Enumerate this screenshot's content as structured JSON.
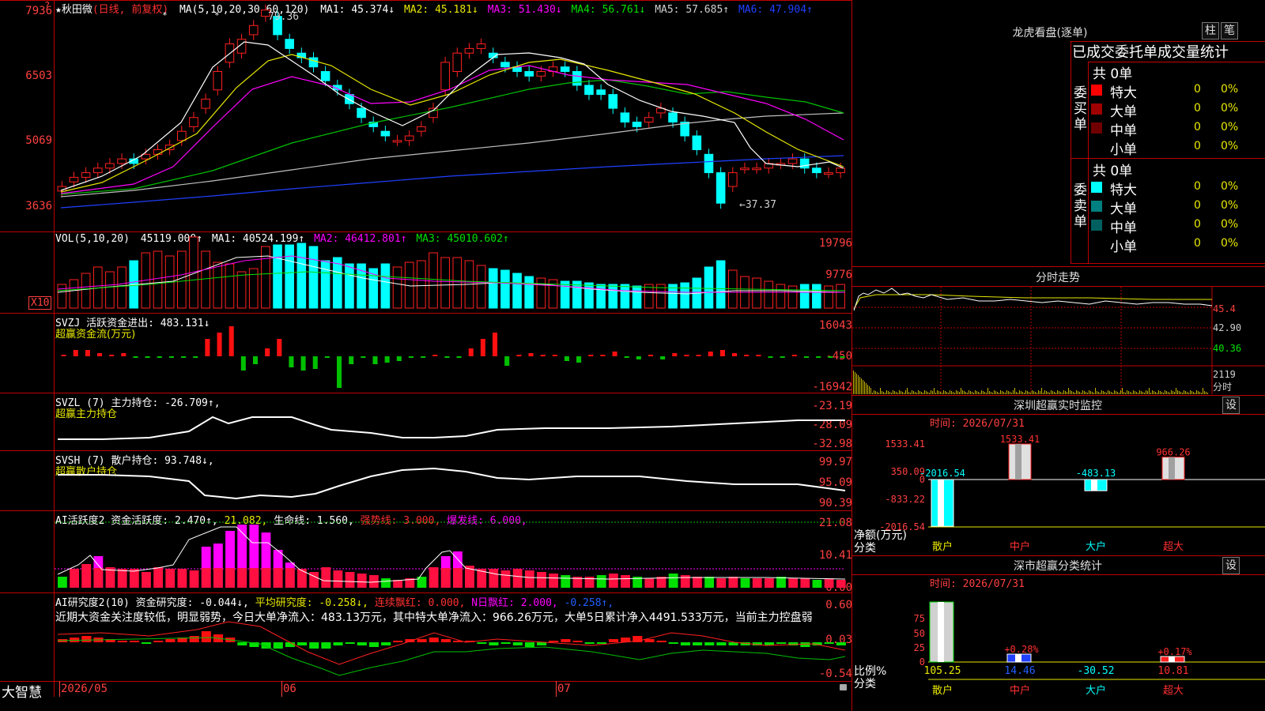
{
  "stock": {
    "star": "★",
    "name": "秋田微",
    "period": "(日线, 前复权)"
  },
  "ma_legend": {
    "params": "MA(5,10,20,30,60,120)",
    "items": [
      {
        "label": "MA1: 45.374↓",
        "color": "#ffffff"
      },
      {
        "label": "MA2: 45.181↓",
        "color": "#e8e800"
      },
      {
        "label": "MA3: 51.430↓",
        "color": "#ff00ff"
      },
      {
        "label": "MA4: 56.761↓",
        "color": "#00e000"
      },
      {
        "label": "MA5: 57.685↑",
        "color": "#c0c0c0"
      },
      {
        "label": "MA6: 47.904↑",
        "color": "#0000ff"
      }
    ]
  },
  "price_axis": [
    "7936",
    "6503",
    "5069",
    "3636"
  ],
  "price_annotations": {
    "high": "79.36",
    "low": "←37.37",
    "question": "?"
  },
  "vol_legend": {
    "params": "VOL(5,10,20)",
    "value": "45119.000↑",
    "items": [
      {
        "label": "MA1: 40524.199↑",
        "color": "#ffffff"
      },
      {
        "label": "MA2: 46412.801↑",
        "color": "#ff00ff"
      },
      {
        "label": "MA3: 45010.602↑",
        "color": "#00e000"
      }
    ]
  },
  "vol_axis": [
    "19796",
    "9776"
  ],
  "vol_unit": "X10",
  "svzj": {
    "title": "SVZJ  活跃资金进出: 483.131↓",
    "sub": "超赢资金流(万元)",
    "axis": [
      "16043",
      "-450",
      "-16942"
    ]
  },
  "svzl": {
    "title": "SVZL (7) 主力持仓: -26.709↑,",
    "sub": "超赢主力持仓",
    "axis": [
      "-23.19",
      "-28.09",
      "-32.98"
    ]
  },
  "svsh": {
    "title": "SVSH (7) 散户持仓: 93.748↓,",
    "sub": "超赢散户持仓",
    "axis": [
      "99.97",
      "95.09",
      "90.39"
    ]
  },
  "ai1": {
    "title": "AI活跃度2 资金活跃度: 2.470↑,",
    "v2": "21.082,",
    "v3": "生命线: 1.560,",
    "v4": "强势线: 3.000,",
    "v5": "爆发线: 6.000,",
    "axis": [
      "21.08",
      "10.41",
      "0.00"
    ]
  },
  "ai2": {
    "title": "AI研究度2(10) 资金研究度: -0.044↓,",
    "v2": "平均研究度: -0.258↓,",
    "v3": "连续飘红: 0.000,",
    "v4": "N日飘红: 2.000,",
    "v5": "-0.258↑,",
    "comment": "近期大资金关注度较低，明显弱势，今日大单净流入：483.13万元，其中特大单净流入：966.26万元，大单5日累计净入4491.533万元，当前主力控盘弱",
    "axis": [
      "0.60",
      "0.03",
      "-0.54"
    ]
  },
  "x_axis": {
    "brand": "大智慧",
    "dates": [
      "2026/05",
      "06",
      "07"
    ]
  },
  "dragon": {
    "title": "龙虎看盘(逐单)",
    "btn1": "柱",
    "btn2": "笔",
    "tabs": "已成交委托单成交量统计",
    "buy_label": "委买单",
    "sell_label": "委卖单",
    "buy_total": "共 0单",
    "sell_total": "共 0单",
    "buy_rows": [
      {
        "name": "特大",
        "count": "0",
        "pct": "0%",
        "color": "#ff0000"
      },
      {
        "name": "大单",
        "count": "0",
        "pct": "0%",
        "color": "#a00000"
      },
      {
        "name": "中单",
        "count": "0",
        "pct": "0%",
        "color": "#700000"
      },
      {
        "name": "小单",
        "count": "0",
        "pct": "0%",
        "color": ""
      }
    ],
    "sell_rows": [
      {
        "name": "特大",
        "count": "0",
        "pct": "0%",
        "color": "#00ffff"
      },
      {
        "name": "大单",
        "count": "0",
        "pct": "0%",
        "color": "#008080"
      },
      {
        "name": "中单",
        "count": "0",
        "pct": "0%",
        "color": "#006060"
      },
      {
        "name": "小单",
        "count": "0",
        "pct": "0%",
        "color": ""
      }
    ]
  },
  "intraday": {
    "title": "分时走势",
    "axis": [
      "45.4",
      "42.90",
      "40.36"
    ],
    "vol": "2119",
    "vol_unit": "分时"
  },
  "monitor": {
    "title": "深圳超赢实时监控",
    "btn": "设",
    "time": "时间: 2026/07/31",
    "axis": [
      "1533.41",
      "350.09",
      "0",
      "-833.22",
      "-2016.54"
    ],
    "bar_labels": [
      "-2016.54",
      "1533.41",
      "-483.13",
      "966.26"
    ],
    "ylabel": "净额(万元)",
    "xlabel": "分类",
    "cats": [
      "散户",
      "中户",
      "大户",
      "超大"
    ]
  },
  "classify": {
    "title": "深市超赢分类统计",
    "btn": "设",
    "time": "时间: 2026/07/31",
    "axis": [
      "75",
      "50",
      "25",
      "0"
    ],
    "bar_labels": [
      "+0.28%",
      "+0.17%"
    ],
    "values": [
      "105.25",
      "14.46",
      "-30.52",
      "10.81"
    ],
    "ylabel": "比例%",
    "xlabel": "分类",
    "cats": [
      "散户",
      "中户",
      "大户",
      "超大"
    ]
  },
  "chart_data": {
    "type": "candlestick",
    "closes": [
      41,
      43,
      44,
      45,
      46,
      47,
      46,
      48,
      49,
      50,
      53,
      56,
      60,
      66,
      72,
      73,
      76,
      79.36,
      74,
      71,
      69,
      67,
      64,
      62,
      59,
      56,
      54,
      52,
      51,
      52,
      54,
      58,
      68,
      70,
      71,
      72,
      69,
      67,
      66,
      65,
      66,
      67,
      66,
      63,
      61,
      61,
      58,
      55,
      54,
      56,
      58,
      55,
      52,
      49,
      44,
      37.37,
      44,
      45,
      45,
      46,
      46,
      47,
      45,
      44,
      44,
      45
    ],
    "opens": [
      40,
      42,
      43,
      44,
      45,
      46,
      47,
      47,
      48,
      49,
      51,
      54,
      58,
      62,
      68,
      70,
      74,
      78,
      78,
      73,
      70,
      69,
      66,
      63,
      61,
      58,
      55,
      53,
      51,
      51,
      53,
      56,
      62,
      66,
      70,
      71,
      70,
      68,
      67,
      66,
      65,
      66,
      67,
      66,
      63,
      62,
      61,
      57,
      55,
      55,
      57,
      57,
      55,
      52,
      48,
      44,
      41,
      45,
      45,
      45,
      46,
      46,
      47,
      45,
      44,
      44
    ]
  }
}
